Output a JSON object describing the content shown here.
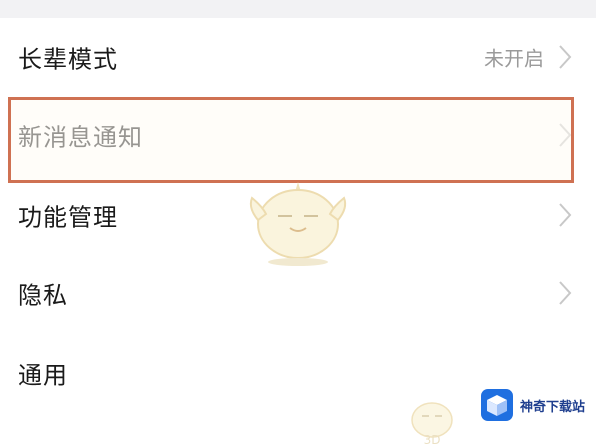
{
  "settings": {
    "items": [
      {
        "label": "长辈模式",
        "value": "未开启",
        "highlighted": false
      },
      {
        "label": "新消息通知",
        "value": "",
        "highlighted": true
      },
      {
        "label": "功能管理",
        "value": "",
        "highlighted": false
      },
      {
        "label": "隐私",
        "value": "",
        "highlighted": false
      },
      {
        "label": "通用",
        "value": "",
        "highlighted": false
      }
    ]
  },
  "annotation": {
    "highlight_color": "#cf7152",
    "target_item": "新消息通知"
  },
  "watermark": {
    "logo_text": "神奇下载站",
    "small_text": "3D",
    "mascot_icon": "chick-mascot-icon",
    "logo_icon": "cube-logo-icon"
  },
  "colors": {
    "label": "#1a1a1a",
    "value": "#9a9a9a",
    "chevron": "#c8c8c8",
    "background": "#ffffff",
    "page_background": "#f2f2f4"
  }
}
